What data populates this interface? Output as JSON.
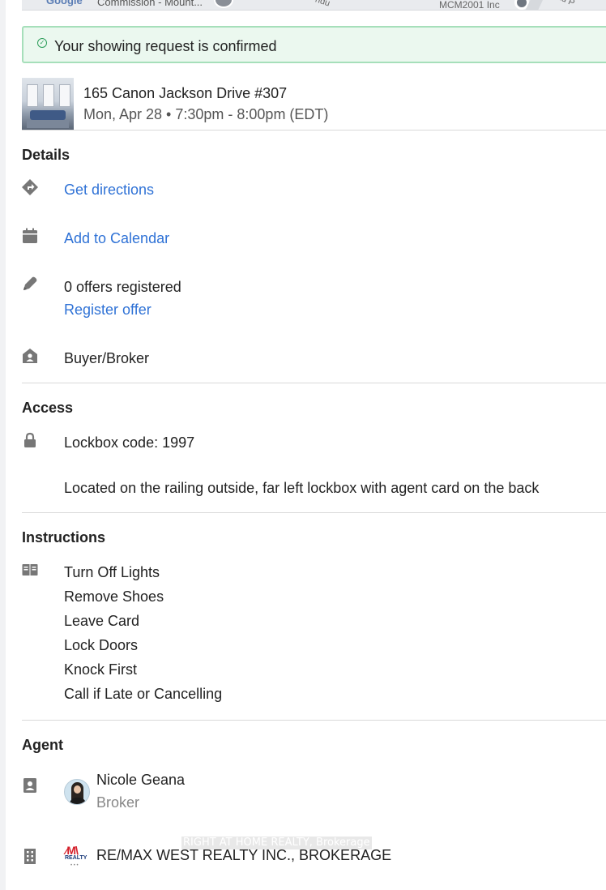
{
  "map": {
    "logo_text": "Google",
    "label_left": "Commission - Mount...",
    "label_mid": "ndu",
    "label_right": "MCM2001 Inc",
    "label_far": "ad P"
  },
  "banner": {
    "message": "Your showing request is confirmed"
  },
  "listing": {
    "address": "165 Canon Jackson Drive #307",
    "datetime": "Mon, Apr 28 • 7:30pm - 8:00pm (EDT)"
  },
  "details": {
    "title": "Details",
    "directions_label": "Get directions",
    "calendar_label": "Add to Calendar",
    "offers_text": "0 offers registered",
    "register_offer_label": "Register offer",
    "role_text": "Buyer/Broker"
  },
  "access": {
    "title": "Access",
    "lockbox": "Lockbox code: 1997",
    "location_note": "Located on the railing outside, far left lockbox with agent card on the back"
  },
  "instructions": {
    "title": "Instructions",
    "items": [
      "Turn Off Lights",
      "Remove Shoes",
      "Leave Card",
      "Lock Doors",
      "Knock First",
      "Call if Late or Cancelling"
    ]
  },
  "agent": {
    "title": "Agent",
    "name": "Nicole Geana",
    "role": "Broker",
    "brokerage": "RE/MAX WEST REALTY INC., BROKERAGE",
    "logo_text": "REALTY"
  },
  "watermark": "RIGHT AT HOME REALTY, Brokerage",
  "colors": {
    "link": "#2f72d6",
    "success_bg": "#ebf8ef",
    "success_border": "#a6dfba",
    "icon": "#777777"
  }
}
